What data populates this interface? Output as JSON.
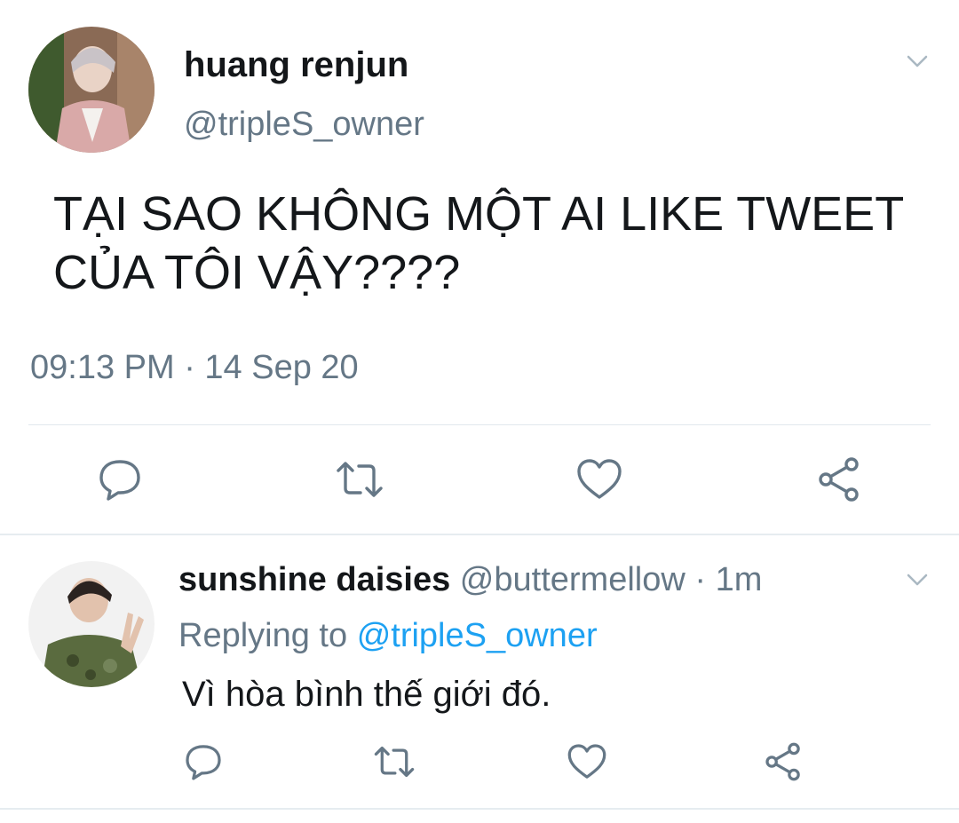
{
  "main_tweet": {
    "author_name": "huang renjun",
    "author_handle": "@tripleS_owner",
    "text": "TẠI SAO KHÔNG MỘT AI LIKE TWEET\nCỦA TÔI VẬY????",
    "timestamp": "09:13 PM · 14 Sep 20",
    "actions": [
      "reply-icon",
      "retweet-icon",
      "like-icon",
      "share-icon"
    ]
  },
  "reply": {
    "author_name": "sunshine daisies",
    "author_handle": "@buttermellow",
    "separator": "·",
    "time_ago": "1m",
    "replying_prefix": "Replying to",
    "replying_to": "@tripleS_owner",
    "text": "Vì hòa bình thế giới đó.",
    "actions": [
      "reply-icon",
      "retweet-icon",
      "like-icon",
      "share-icon"
    ]
  },
  "colors": {
    "text_primary": "#14171a",
    "text_secondary": "#657786",
    "mention": "#1da1f2",
    "icon": "#657786",
    "divider": "#e1e8ed"
  }
}
